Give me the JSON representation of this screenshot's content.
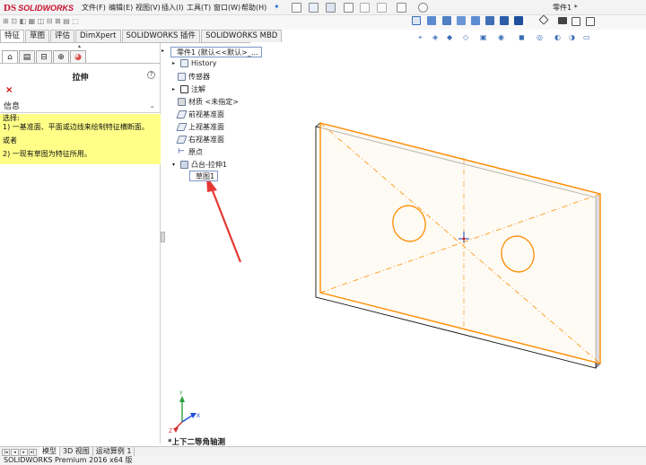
{
  "app": {
    "logo": "SOLIDWORKS",
    "logo_mark": "DS",
    "document_title": "零件1 *",
    "status": "SOLIDWORKS Premium 2016 x64 版"
  },
  "menu": [
    "文件(F)",
    "编辑(E)",
    "视图(V)",
    "插入(I)",
    "工具(T)",
    "窗口(W)",
    "帮助(H)"
  ],
  "command_tabs": [
    {
      "label": "特征",
      "active": true
    },
    {
      "label": "草图",
      "active": false
    },
    {
      "label": "评估",
      "active": false
    },
    {
      "label": "DimXpert",
      "active": false
    },
    {
      "label": "SOLIDWORKS 插件",
      "active": false
    },
    {
      "label": "SOLIDWORKS MBD",
      "active": false
    }
  ],
  "property_manager": {
    "title": "拉伸",
    "help_glyph": "?",
    "cancel_glyph": "×",
    "info_header": "信息",
    "info_lines": [
      "选择:",
      "1) 一基准面、平面或边线来绘制特征横断面。",
      "或者",
      "2) 一现有草图为特征所用。"
    ]
  },
  "feature_tree": {
    "root": "零件1 (默认<<默认>_...",
    "items": [
      {
        "label": "History",
        "expandable": true,
        "icon": "history-icon"
      },
      {
        "label": "传感器",
        "expandable": false,
        "icon": "sensor-icon"
      },
      {
        "label": "注解",
        "expandable": true,
        "icon": "annotation-icon"
      },
      {
        "label": "材质 <未指定>",
        "expandable": false,
        "icon": "material-icon"
      },
      {
        "label": "前视基准面",
        "expandable": false,
        "icon": "plane-icon"
      },
      {
        "label": "上视基准面",
        "expandable": false,
        "icon": "plane-icon"
      },
      {
        "label": "右视基准面",
        "expandable": false,
        "icon": "plane-icon"
      },
      {
        "label": "原点",
        "expandable": false,
        "icon": "origin-icon"
      },
      {
        "label": "凸台-拉伸1",
        "expandable": true,
        "icon": "extrude-icon"
      }
    ],
    "sketch": "草图1"
  },
  "viewport": {
    "orientation_label": "*上下二等角轴测",
    "highlight_color": "#ff8c00",
    "annotation_color": "#e53935"
  },
  "bottom_tabs": [
    {
      "label": "模型",
      "active": true
    },
    {
      "label": "3D 视图",
      "active": false
    },
    {
      "label": "运动算例 1",
      "active": false
    }
  ]
}
